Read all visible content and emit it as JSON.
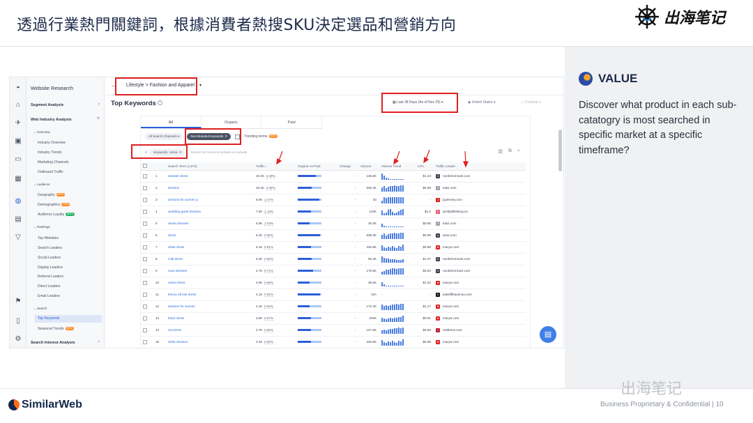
{
  "slide": {
    "title": "透過行業熱門關鍵詞，根據消費者熱搜SKU決定選品和營銷方向",
    "brand": "出海笔记",
    "footer_confidential": "Business Proprietary & Confidential  |  10",
    "footer_logo": "SimilarWeb",
    "watermark": "出海笔记"
  },
  "value": {
    "title": "VALUE",
    "text": "Discover what product in each sub-catatogry is most searched in specific market at a specific timeframe?"
  },
  "nav": {
    "header": "Website Research",
    "segment": "Segment Analysis",
    "industry": "Web Industry Analysis",
    "overview_head": "Overview",
    "overview_items": [
      "Industry Overview",
      "Industry Trends",
      "Marketing Channels",
      "Outbound Traffic"
    ],
    "audience_head": "Audience",
    "audience_items": [
      "Geography",
      "Demographics",
      "Audience Loyalty"
    ],
    "audience_badges": [
      "NEW",
      "NEW",
      "BETA"
    ],
    "rankings_head": "Rankings",
    "rankings_items": [
      "Top Websites",
      "Search Leaders",
      "Social Leaders",
      "Display Leaders",
      "Referral Leaders",
      "Direct Leaders",
      "Email Leaders"
    ],
    "search_head": "Search",
    "search_items": [
      "Top Keywords",
      "Seasonal Trends"
    ],
    "seasonal_badge": "NEW",
    "interest": "Search Interest Analysis"
  },
  "topbar": {
    "breadcrumb": "Lifestyle > Fashion and Apparel",
    "page_title": "Top Keywords",
    "date": "Last 28 Days (As of Nov 29)",
    "country": "United States",
    "device": "Desktop"
  },
  "tabs": [
    "All",
    "Organic",
    "Paid"
  ],
  "filters": {
    "channels": "All Search Channels",
    "branded": "Non-Branded keywords",
    "trending": "Trending terms",
    "trending_badge": "NEW",
    "keyword_chip": "Keywords : dress",
    "search_placeholder": "Search for terms to include or exclude"
  },
  "table": {
    "columns": [
      "Search Term (1,675)",
      "Traffic",
      "Organic vs Paid",
      "Change",
      "Volume",
      "Volume Trend",
      "CPC",
      "Traffic Leader"
    ],
    "rows": [
      {
        "n": "1",
        "term": "sweater dress",
        "traffic": "23.3K",
        "share": "3.49%",
        "organic": 0.75,
        "change": "-",
        "volume": "135.6K",
        "cpc": "$1.23",
        "leader": "nordstromrack.com",
        "fav": "H",
        "favcolor": "#3a4150"
      },
      {
        "n": "2",
        "term": "dresses",
        "traffic": "16.4K",
        "share": "2.45%",
        "organic": 0.6,
        "change": "-",
        "volume": "535.3K",
        "cpc": "$0.96",
        "leader": "lulus.com",
        "fav": "V",
        "favcolor": "#9aa1ad"
      },
      {
        "n": "3",
        "term": "dresses for women jc",
        "traffic": "8.5K",
        "share": "1.27%",
        "organic": 0.9,
        "change": "-",
        "volume": "30",
        "cpc": "-",
        "leader": "jcpenney.com",
        "fav": "J",
        "favcolor": "#e02020"
      },
      {
        "n": "4",
        "term": "wedding guest dresses",
        "traffic": "7.6K",
        "share": "1.14%",
        "organic": 0.55,
        "change": "-",
        "volume": "132K",
        "cpc": "$1.2",
        "leader": "prettylittlething.us",
        "fav": "P",
        "favcolor": "#e0607a"
      },
      {
        "n": "5",
        "term": "winter dresses",
        "traffic": "6.9K",
        "share": "1.03%",
        "organic": 0.5,
        "change": "-",
        "volume": "26.4K",
        "cpc": "$0.85",
        "leader": "lulus.com",
        "fav": "V",
        "favcolor": "#9aa1ad"
      },
      {
        "n": "6",
        "term": "dress",
        "traffic": "6.4K",
        "share": "0.96%",
        "organic": 0.95,
        "change": "-",
        "volume": "535.3K",
        "cpc": "$0.96",
        "leader": "asos.com",
        "fav": "a",
        "favcolor": "#3a4150"
      },
      {
        "n": "7",
        "term": "white dress",
        "traffic": "6.1K",
        "share": "0.91%",
        "organic": 0.55,
        "change": "-",
        "volume": "248.9K",
        "cpc": "$0.88",
        "leader": "macys.com",
        "fav": "★",
        "favcolor": "#e02020"
      },
      {
        "n": "8",
        "term": "midi dress",
        "traffic": "5.3K",
        "share": "0.80%",
        "organic": 0.6,
        "change": "-",
        "volume": "65.4K",
        "cpc": "$1.37",
        "leader": "nordstromrack.com",
        "fav": "H",
        "favcolor": "#3a4150"
      },
      {
        "n": "9",
        "term": "maxi dresses",
        "traffic": "4.7K",
        "share": "0.71%",
        "organic": 0.65,
        "change": "-",
        "volume": "179.5K",
        "cpc": "$0.92",
        "leader": "nordstromrack.com",
        "fav": "H",
        "favcolor": "#3a4150"
      },
      {
        "n": "10",
        "term": "velvet dress",
        "traffic": "4.5K",
        "share": "0.68%",
        "organic": 0.5,
        "change": "-",
        "volume": "35.5K",
        "cpc": "$1.02",
        "leader": "macys.com",
        "fav": "★",
        "favcolor": "#e02020"
      },
      {
        "n": "11",
        "term": "theory rib knit dress",
        "traffic": "4.1K",
        "share": "0.62%",
        "organic": 0.95,
        "change": "-",
        "volume": "N/A",
        "cpc": "-",
        "leader": "saksfifthavenue.com",
        "fav": "S",
        "favcolor": "#111111"
      },
      {
        "n": "12",
        "term": "dresses for women",
        "traffic": "4.1K",
        "share": "0.62%",
        "organic": 0.5,
        "change": "-",
        "volume": "170.4K",
        "cpc": "$1.17",
        "leader": "macys.com",
        "fav": "★",
        "favcolor": "#e02020"
      },
      {
        "n": "13",
        "term": "black dress",
        "traffic": "3.8K",
        "share": "0.57%",
        "organic": 0.55,
        "change": "-",
        "volume": "204K",
        "cpc": "$0.81",
        "leader": "macys.com",
        "fav": "★",
        "favcolor": "#e02020"
      },
      {
        "n": "14",
        "term": "red dress",
        "traffic": "3.7K",
        "share": "0.55%",
        "organic": 0.55,
        "change": "-",
        "volume": "147.5K",
        "cpc": "$0.66",
        "leader": "reddress.com",
        "fav": "r",
        "favcolor": "#c0203a"
      },
      {
        "n": "15",
        "term": "white dresses",
        "traffic": "3.4K",
        "share": "0.50%",
        "organic": 0.55,
        "change": "-",
        "volume": "248.9K",
        "cpc": "$0.88",
        "leader": "macys.com",
        "fav": "★",
        "favcolor": "#e02020"
      }
    ]
  },
  "colors": {
    "accent": "#2b5fd9",
    "highlight": "#e01e1e",
    "bar_light": "#a8c6f5"
  }
}
